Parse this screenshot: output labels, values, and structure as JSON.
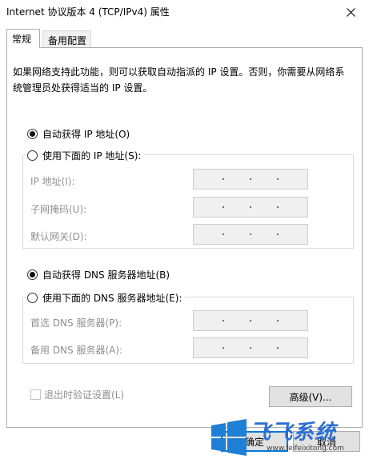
{
  "window": {
    "title": "Internet 协议版本 4 (TCP/IPv4) 属性"
  },
  "tabs": [
    {
      "label": "常规",
      "active": true
    },
    {
      "label": "备用配置",
      "active": false
    }
  ],
  "description": "如果网络支持此功能，则可以获取自动指派的 IP 设置。否则，你需要从网络系统管理员处获得适当的 IP 设置。",
  "ip": {
    "auto_label": "自动获得 IP 地址(O)",
    "auto_selected": true,
    "manual_label": "使用下面的 IP 地址(S):",
    "fields": [
      {
        "label": "IP 地址(I):"
      },
      {
        "label": "子网掩码(U):"
      },
      {
        "label": "默认网关(D):"
      }
    ]
  },
  "dns": {
    "auto_label": "自动获得 DNS 服务器地址(B)",
    "auto_selected": true,
    "manual_label": "使用下面的 DNS 服务器地址(E):",
    "fields": [
      {
        "label": "首选 DNS 服务器(P):"
      },
      {
        "label": "备用 DNS 服务器(A):"
      }
    ]
  },
  "validate_checkbox": {
    "label": "退出时验证设置(L)",
    "checked": false,
    "enabled": false
  },
  "buttons": {
    "advanced": "高级(V)...",
    "ok": "确定",
    "cancel": "取消"
  },
  "watermark": {
    "brand": "飞飞系统",
    "url": "www.feifeixitong.com"
  },
  "colors": {
    "accent": "#0078d7",
    "brand": "#2a6fd3"
  }
}
